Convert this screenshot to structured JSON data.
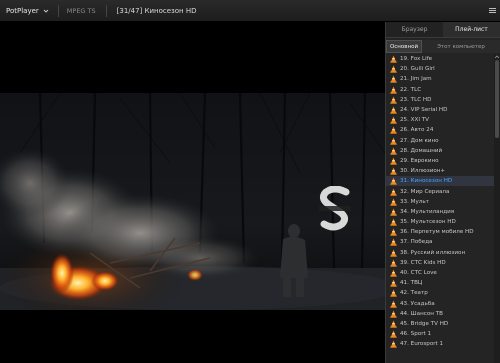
{
  "titlebar": {
    "app_name": "PotPlayer",
    "format": "MPEG TS",
    "file_title": "[31/47] Киносезон HD"
  },
  "panel": {
    "tabs": [
      {
        "label": "Браузер",
        "active": false
      },
      {
        "label": "Плей-лист",
        "active": true
      }
    ],
    "sub_tabs": [
      {
        "label": "Основной",
        "active": true
      },
      {
        "label": "Этот компьютер",
        "active": false
      }
    ],
    "playlist": [
      {
        "label": "19. Fox Life",
        "current": false
      },
      {
        "label": "20. Gulli Girl",
        "current": false
      },
      {
        "label": "21. Jim Jam",
        "current": false
      },
      {
        "label": "22. TLC",
        "current": false
      },
      {
        "label": "23. TLC HD",
        "current": false
      },
      {
        "label": "24. VIP Serial HD",
        "current": false
      },
      {
        "label": "25. XXI TV",
        "current": false
      },
      {
        "label": "26. Авто 24",
        "current": false
      },
      {
        "label": "27. Дом кино",
        "current": false
      },
      {
        "label": "28. Домашний",
        "current": false
      },
      {
        "label": "29. Еврокино",
        "current": false
      },
      {
        "label": "30. Иллюзион+",
        "current": false
      },
      {
        "label": "31. Киносезон HD",
        "current": true
      },
      {
        "label": "32. Мир Сериала",
        "current": false
      },
      {
        "label": "33. Мульт",
        "current": false
      },
      {
        "label": "34. Мультиландия",
        "current": false
      },
      {
        "label": "35. Мультсезон HD",
        "current": false
      },
      {
        "label": "36. Перпетум мобиле HD",
        "current": false
      },
      {
        "label": "37. Победа",
        "current": false
      },
      {
        "label": "38. Русский иллюзион",
        "current": false
      },
      {
        "label": "39. СТС Kids HD",
        "current": false
      },
      {
        "label": "40. СТС Love",
        "current": false
      },
      {
        "label": "41. ТВЦ",
        "current": false
      },
      {
        "label": "42. Театр",
        "current": false
      },
      {
        "label": "43. Усадьба",
        "current": false
      },
      {
        "label": "44. Шансон ТВ",
        "current": false
      },
      {
        "label": "45. Bridge TV HD",
        "current": false
      },
      {
        "label": "46. Sport 1",
        "current": false
      },
      {
        "label": "47. Eurosport 1",
        "current": false
      }
    ]
  },
  "colors": {
    "current_item": "#4aa3ff",
    "cone_orange": "#f08a1c"
  },
  "icons": {
    "playlist_item": "vlc-cone-icon",
    "menu": "hamburger-menu-icon",
    "logo_dropdown": "chevron-down-icon"
  }
}
